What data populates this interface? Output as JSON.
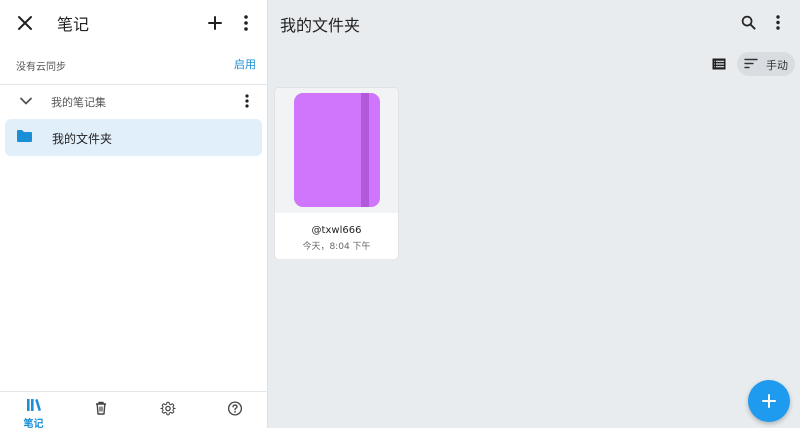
{
  "sidebar": {
    "title": "笔记",
    "sync_status": "没有云同步",
    "sync_enable_label": "启用",
    "collection": {
      "label": "我的笔记集"
    },
    "folders": [
      {
        "label": "我的文件夹"
      }
    ],
    "bottom_nav": {
      "notes_label": "笔记"
    }
  },
  "main": {
    "title": "我的文件夹",
    "sort_label": "手动",
    "notebooks": [
      {
        "name": "@txwl666",
        "date": "今天，8:04 下午",
        "cover_color": "#cf76fc"
      }
    ]
  },
  "colors": {
    "accent": "#1a8fd6",
    "fab": "#1e9bef",
    "selected_bg": "#e1effb"
  },
  "icons": [
    "close-icon",
    "plus-icon",
    "more-vert-icon",
    "chevron-down-icon",
    "folder-icon",
    "notes-library-icon",
    "trash-icon",
    "gear-icon",
    "help-icon",
    "search-icon",
    "list-view-icon",
    "sort-icon"
  ]
}
